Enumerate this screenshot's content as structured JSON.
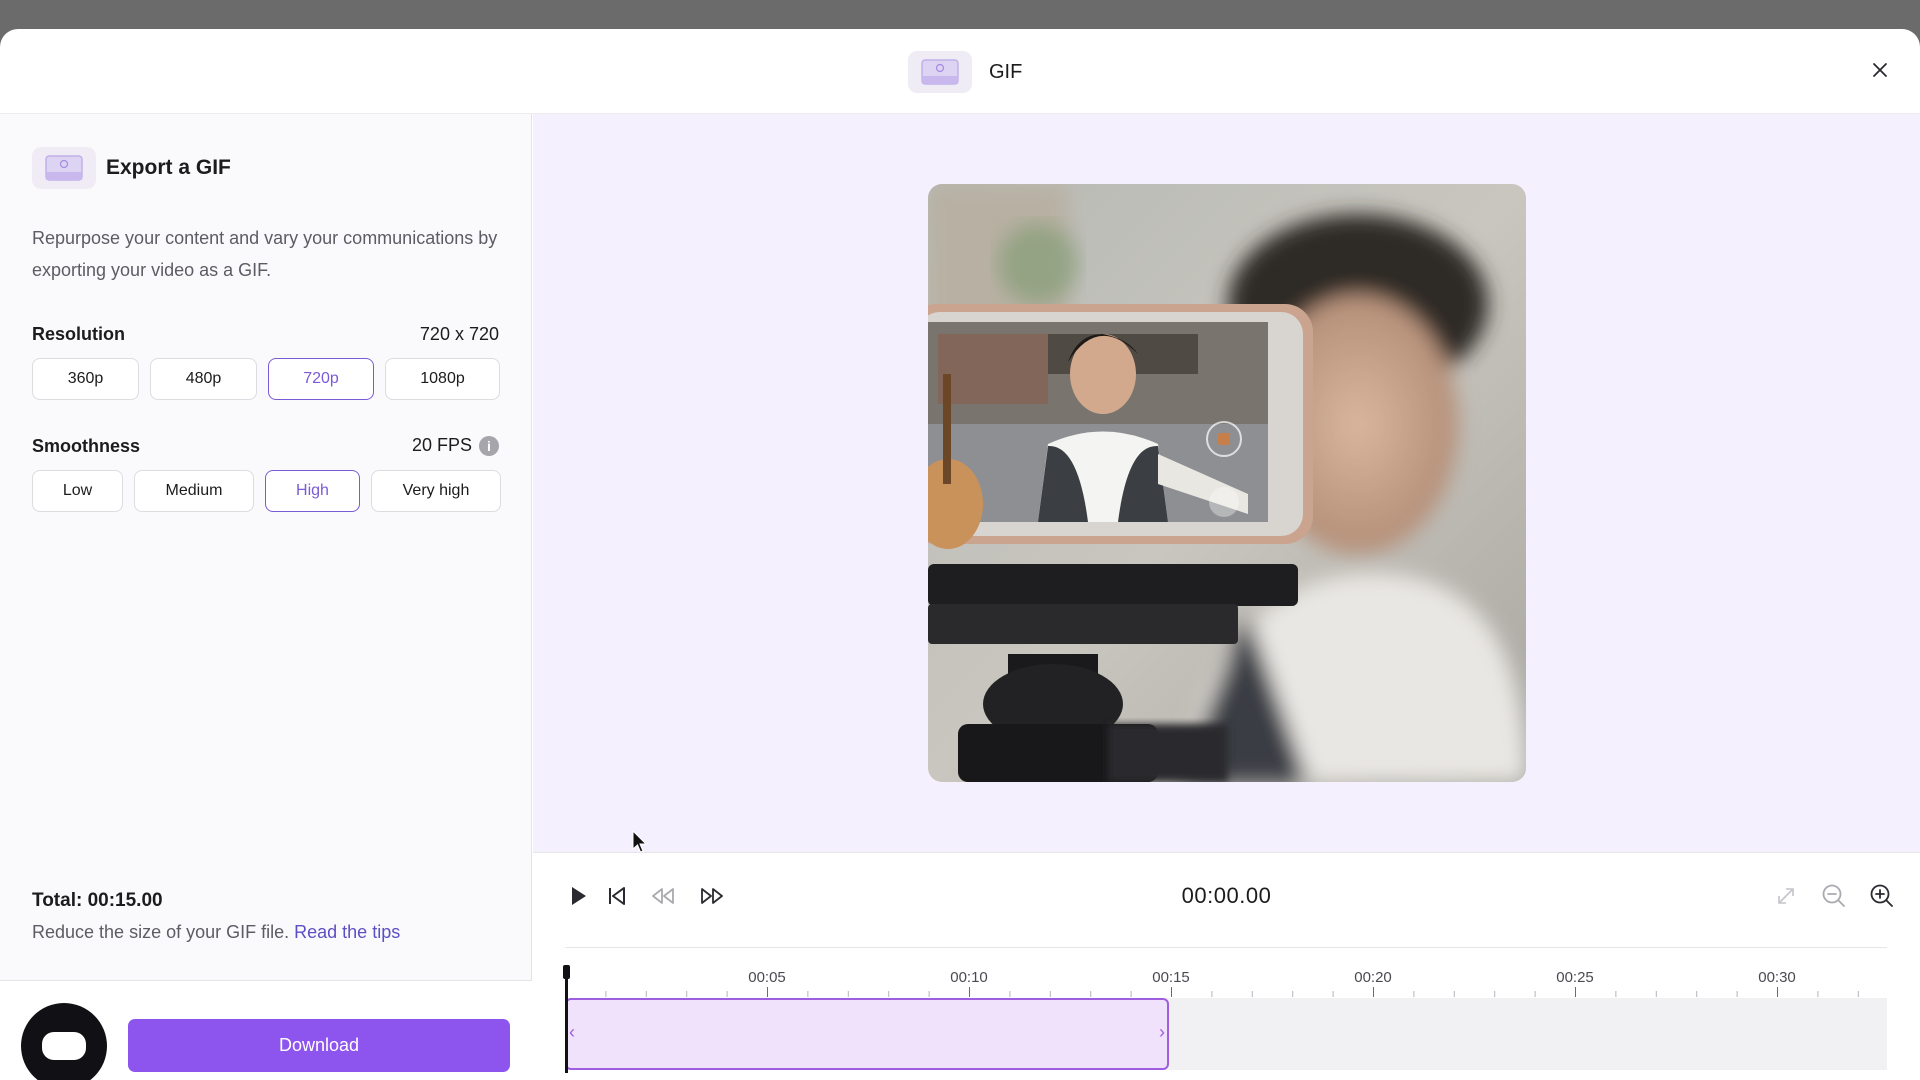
{
  "header": {
    "title": "GIF",
    "icon": "gif-icon"
  },
  "export": {
    "title": "Export a GIF",
    "description": "Repurpose your content and vary your communications by exporting your video as a GIF."
  },
  "resolution": {
    "label": "Resolution",
    "value": "720 x 720",
    "options": [
      "360p",
      "480p",
      "720p",
      "1080p"
    ],
    "selected": "720p"
  },
  "smoothness": {
    "label": "Smoothness",
    "value": "20 FPS",
    "options": [
      "Low",
      "Medium",
      "High",
      "Very high"
    ],
    "selected": "High"
  },
  "summary": {
    "total": "Total: 00:15.00",
    "reduce_text": "Reduce the size of your GIF file.",
    "tips_link": "Read the tips"
  },
  "footer": {
    "download_label": "Download"
  },
  "player": {
    "current_time": "00:00.00",
    "tick_labels": [
      "00:05",
      "00:10",
      "00:15",
      "00:20",
      "00:25",
      "00:30"
    ]
  },
  "colors": {
    "accent": "#8e54ee",
    "selected_border": "#7b5ad6",
    "clip_fill": "#f0e2fb",
    "preview_bg": "#f5f0fd"
  }
}
